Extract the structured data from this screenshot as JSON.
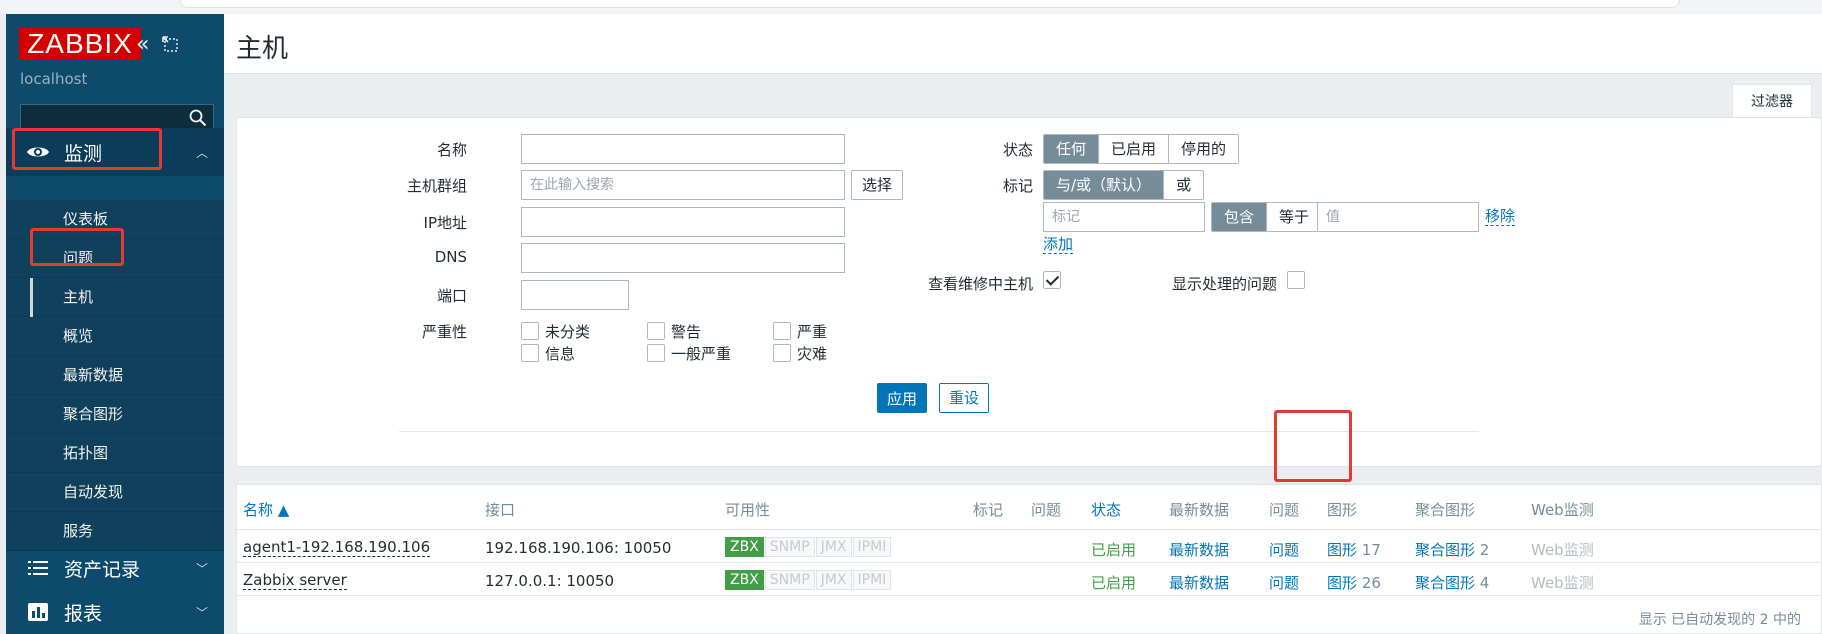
{
  "app": {
    "logo": "ZABBIX",
    "hostname": "localhost"
  },
  "sidebar": {
    "sections": [
      {
        "label": "监测",
        "icon": "eye-icon"
      },
      {
        "label": "资产记录",
        "icon": "list-icon"
      },
      {
        "label": "报表",
        "icon": "bar-chart-icon"
      }
    ],
    "monitoring_items": [
      {
        "label": "仪表板"
      },
      {
        "label": "问题"
      },
      {
        "label": "主机"
      },
      {
        "label": "概览"
      },
      {
        "label": "最新数据"
      },
      {
        "label": "聚合图形"
      },
      {
        "label": "拓扑图"
      },
      {
        "label": "自动发现"
      },
      {
        "label": "服务"
      }
    ]
  },
  "page": {
    "title": "主机",
    "filter_tab": "过滤器"
  },
  "filter": {
    "name_label": "名称",
    "hostgroup_label": "主机群组",
    "hostgroup_placeholder": "在此输入搜索",
    "select_button": "选择",
    "ip_label": "IP地址",
    "dns_label": "DNS",
    "port_label": "端口",
    "severity_label": "严重性",
    "severities": [
      "未分类",
      "警告",
      "严重",
      "信息",
      "一般严重",
      "灾难"
    ],
    "status_label": "状态",
    "status_options": [
      "任何",
      "已启用",
      "停用的"
    ],
    "tags_label": "标记",
    "tags_ops": [
      "与/或（默认）",
      "或"
    ],
    "tag_placeholder": "标记",
    "tag_match_options": [
      "包含",
      "等于"
    ],
    "value_placeholder": "值",
    "remove_link": "移除",
    "add_link": "添加",
    "maint_label": "查看维修中主机",
    "maint_checked": true,
    "show_suppressed_label": "显示处理的问题",
    "show_suppressed_checked": false,
    "apply_button": "应用",
    "reset_button": "重设"
  },
  "table": {
    "columns": [
      "名称 ▲",
      "接口",
      "可用性",
      "标记",
      "问题",
      "状态",
      "最新数据",
      "问题",
      "图形",
      "聚合图形",
      "Web监测"
    ],
    "rows": [
      {
        "name": "agent1-192.168.190.106",
        "interface": "192.168.190.106: 10050",
        "availability": [
          "ZBX",
          "SNMP",
          "JMX",
          "IPMI"
        ],
        "status": "已启用",
        "latest": "最新数据",
        "problems": "问题",
        "graphs": "图形",
        "graphs_count": "17",
        "screens": "聚合图形",
        "screens_count": "2",
        "web": "Web监测"
      },
      {
        "name": "Zabbix server",
        "interface": "127.0.0.1: 10050",
        "availability": [
          "ZBX",
          "SNMP",
          "JMX",
          "IPMI"
        ],
        "status": "已启用",
        "latest": "最新数据",
        "problems": "问题",
        "graphs": "图形",
        "graphs_count": "26",
        "screens": "聚合图形",
        "screens_count": "4",
        "web": "Web监测"
      }
    ],
    "footer": "显示 已自动发现的 2 中的"
  }
}
